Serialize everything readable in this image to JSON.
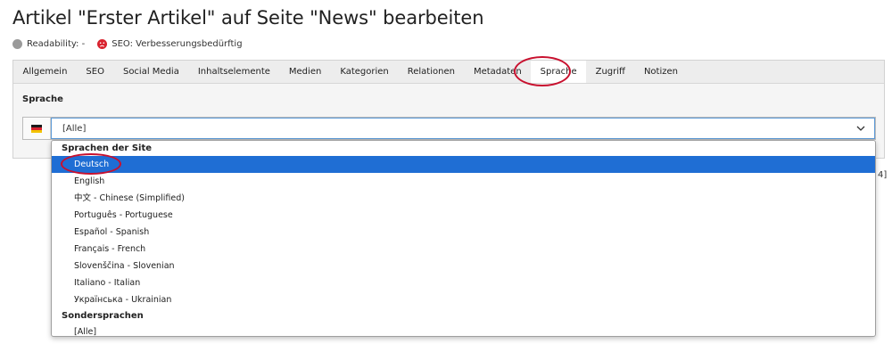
{
  "page": {
    "title": "Artikel \"Erster Artikel\" auf Seite \"News\" bearbeiten"
  },
  "status": {
    "readability": "Readability: -",
    "seo": "SEO: Verbesserungsbedürftig",
    "readability_color": "#9a9a9a",
    "seo_color": "#d9232f"
  },
  "tabs": [
    {
      "label": "Allgemein"
    },
    {
      "label": "SEO"
    },
    {
      "label": "Social Media"
    },
    {
      "label": "Inhaltselemente"
    },
    {
      "label": "Medien"
    },
    {
      "label": "Kategorien"
    },
    {
      "label": "Relationen"
    },
    {
      "label": "Metadaten"
    },
    {
      "label": "Sprache",
      "active": true
    },
    {
      "label": "Zugriff"
    },
    {
      "label": "Notizen"
    }
  ],
  "language_section": {
    "label": "Sprache",
    "selected_value": "[Alle]",
    "flag_icon": "multi-language-flag-icon"
  },
  "side_text": "4]",
  "dropdown": {
    "group_site": "Sprachen der Site",
    "site_options": [
      {
        "label": "Deutsch",
        "selected": true
      },
      {
        "label": "English"
      },
      {
        "label": "中文 - Chinese (Simplified)"
      },
      {
        "label": "Português - Portuguese"
      },
      {
        "label": "Español - Spanish"
      },
      {
        "label": "Français - French"
      },
      {
        "label": "Slovenščina - Slovenian"
      },
      {
        "label": "Italiano - Italian"
      },
      {
        "label": "Українська - Ukrainian"
      }
    ],
    "group_special": "Sondersprachen",
    "special_options": [
      {
        "label": "[Alle]"
      }
    ]
  },
  "colors": {
    "highlight_ring": "#c8102e",
    "selected_option_bg": "#1f6ed4",
    "select_focus_border": "#5c9ad8"
  }
}
